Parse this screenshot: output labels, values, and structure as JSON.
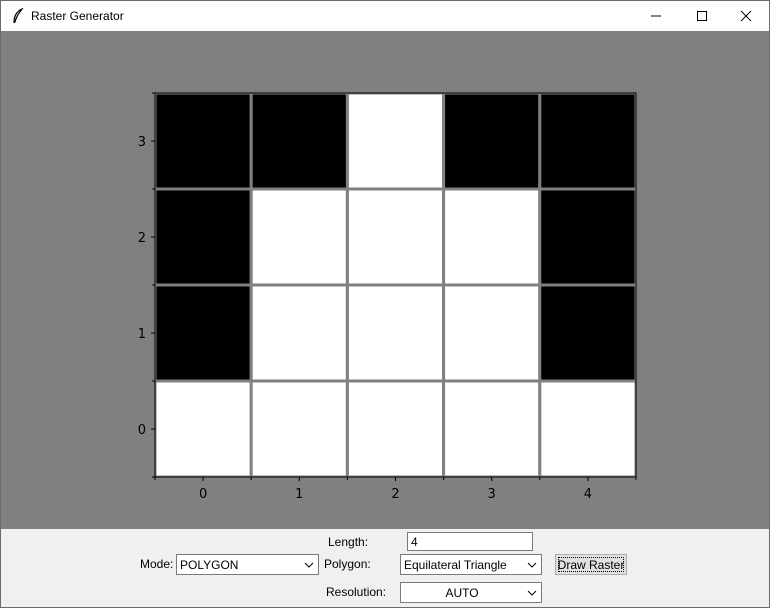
{
  "window": {
    "title": "Raster Generator"
  },
  "raster": {
    "x_ticks": [
      "0",
      "1",
      "2",
      "3",
      "4"
    ],
    "y_ticks": [
      "0",
      "1",
      "2",
      "3"
    ],
    "rows_bottom_to_top": [
      [
        0,
        0,
        0,
        0,
        0
      ],
      [
        1,
        0,
        0,
        0,
        1
      ],
      [
        1,
        0,
        0,
        0,
        1
      ],
      [
        1,
        1,
        0,
        1,
        1
      ]
    ],
    "filled_color": "#000000",
    "empty_color": "#ffffff",
    "grid_color": "#808080",
    "background_color": "#808080"
  },
  "controls": {
    "length_label": "Length:",
    "length_value": "4",
    "mode_label": "Mode:",
    "mode_value": "POLYGON",
    "polygon_label": "Polygon:",
    "polygon_value": "Equilateral Triangle",
    "draw_button": "Draw Raster",
    "resolution_label": "Resolution:",
    "resolution_value": "AUTO"
  },
  "icons": {
    "app": "feather-icon",
    "minimize": "minimize-icon",
    "maximize": "maximize-icon",
    "close": "close-icon",
    "dropdown": "chevron-down-icon"
  }
}
